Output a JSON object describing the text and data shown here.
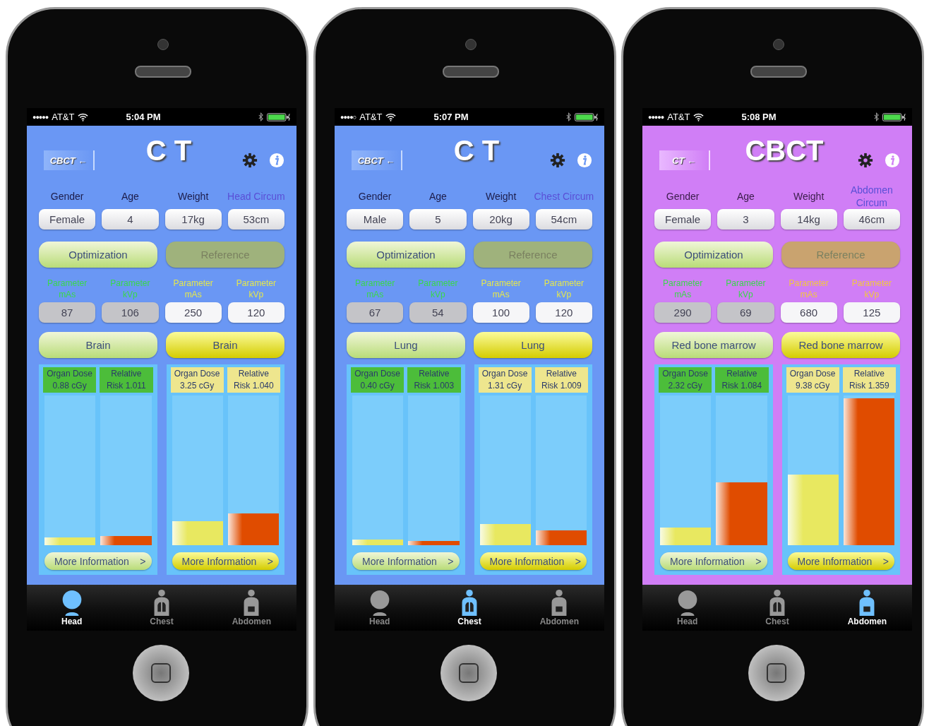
{
  "phones": [
    {
      "kind": "ct",
      "status": {
        "signal": "●●●●●",
        "carrier": "AT&T",
        "time": "5:04 PM"
      },
      "switch_button": "CBCT ←",
      "title": "C T",
      "fields": [
        {
          "label": "Gender",
          "value": "Female",
          "color": "#1c1c4a"
        },
        {
          "label": "Age",
          "value": "4",
          "color": "#1c1c4a"
        },
        {
          "label": "Weight",
          "value": "17kg",
          "color": "#1c1c4a"
        },
        {
          "label": "Head Circum",
          "value": "53cm",
          "color": "#5a4fd6"
        }
      ],
      "mode_buttons": [
        {
          "label": "Optimization",
          "disabled": false
        },
        {
          "label": "Reference",
          "disabled": true
        }
      ],
      "params": [
        {
          "label": "Parameter mAs",
          "value": "87",
          "kind": "optimization",
          "color": "#39d84a"
        },
        {
          "label": "Parameter kVp",
          "value": "106",
          "kind": "optimization",
          "color": "#39d84a"
        },
        {
          "label": "Parameter mAs",
          "value": "250",
          "kind": "reference",
          "color": "#e6e84a"
        },
        {
          "label": "Parameter kVp",
          "value": "120",
          "kind": "reference",
          "color": "#e6e84a"
        }
      ],
      "columns": [
        {
          "kind": "optimization",
          "organ": "Brain",
          "dose": "Organ Dose\n0.88 cGy",
          "risk": "Relative\nRisk 1.011",
          "dose_bar": {
            "level": 0.05
          },
          "risk_bar": {
            "level": 0.06
          },
          "more_button": "More Information",
          "more_arrow": ">"
        },
        {
          "kind": "reference",
          "organ": "Brain",
          "dose": "Organ Dose\n3.25 cGy",
          "risk": "Relative\nRisk 1.040",
          "dose_bar": {
            "level": 0.16
          },
          "risk_bar": {
            "level": 0.21
          },
          "more_button": "More Information",
          "more_arrow": ">"
        }
      ],
      "tabs": [
        {
          "label": "Head",
          "selected": true,
          "kind": "head"
        },
        {
          "label": "Chest",
          "selected": false,
          "kind": "chest"
        },
        {
          "label": "Abdomen",
          "selected": false,
          "kind": "abdomen"
        }
      ]
    },
    {
      "kind": "ct",
      "status": {
        "signal": "●●●●○",
        "carrier": "AT&T",
        "time": "5:07 PM"
      },
      "switch_button": "CBCT ←",
      "title": "C T",
      "fields": [
        {
          "label": "Gender",
          "value": "Male",
          "color": "#1c1c4a"
        },
        {
          "label": "Age",
          "value": "5",
          "color": "#1c1c4a"
        },
        {
          "label": "Weight",
          "value": "20kg",
          "color": "#1c1c4a"
        },
        {
          "label": "Chest Circum",
          "value": "54cm",
          "color": "#5a4fd6"
        }
      ],
      "mode_buttons": [
        {
          "label": "Optimization",
          "disabled": false
        },
        {
          "label": "Reference",
          "disabled": true
        }
      ],
      "params": [
        {
          "label": "Parameter mAs",
          "value": "67",
          "kind": "optimization",
          "color": "#39d84a"
        },
        {
          "label": "Parameter kVp",
          "value": "54",
          "kind": "optimization",
          "color": "#39d84a"
        },
        {
          "label": "Parameter mAs",
          "value": "100",
          "kind": "reference",
          "color": "#e6e84a"
        },
        {
          "label": "Parameter kVp",
          "value": "120",
          "kind": "reference",
          "color": "#e6e84a"
        }
      ],
      "columns": [
        {
          "kind": "optimization",
          "organ": "Lung",
          "dose": "Organ Dose\n0.40 cGy",
          "risk": "Relative\nRisk 1.003",
          "dose_bar": {
            "level": 0.04
          },
          "risk_bar": {
            "level": 0.03
          },
          "more_button": "More Information",
          "more_arrow": ">"
        },
        {
          "kind": "reference",
          "organ": "Lung",
          "dose": "Organ Dose\n1.31 cGy",
          "risk": "Relative\nRisk 1.009",
          "dose_bar": {
            "level": 0.14
          },
          "risk_bar": {
            "level": 0.1
          },
          "more_button": "More Information",
          "more_arrow": ">"
        }
      ],
      "tabs": [
        {
          "label": "Head",
          "selected": false,
          "kind": "head"
        },
        {
          "label": "Chest",
          "selected": true,
          "kind": "chest"
        },
        {
          "label": "Abdomen",
          "selected": false,
          "kind": "abdomen"
        }
      ]
    },
    {
      "kind": "cbct",
      "status": {
        "signal": "●●●●●",
        "carrier": "AT&T",
        "time": "5:08 PM"
      },
      "switch_button": "CT ←",
      "title": "CBCT",
      "fields": [
        {
          "label": "Gender",
          "value": "Female",
          "color": "#3a1c4a"
        },
        {
          "label": "Age",
          "value": "3",
          "color": "#3a1c4a"
        },
        {
          "label": "Weight",
          "value": "14kg",
          "color": "#3a1c4a"
        },
        {
          "label": "Abdomen Circum",
          "value": "46cm",
          "color": "#5a4fd6"
        }
      ],
      "mode_buttons": [
        {
          "label": "Optimization",
          "disabled": false
        },
        {
          "label": "Reference",
          "disabled": true
        }
      ],
      "params": [
        {
          "label": "Parameter mAs",
          "value": "290",
          "kind": "optimization",
          "color": "#39d84a"
        },
        {
          "label": "Parameter kVp",
          "value": "69",
          "kind": "optimization",
          "color": "#39d84a"
        },
        {
          "label": "Parameter mAs",
          "value": "680",
          "kind": "reference",
          "color": "#f2c83c"
        },
        {
          "label": "Parameter kVp",
          "value": "125",
          "kind": "reference",
          "color": "#f2c83c"
        }
      ],
      "columns": [
        {
          "kind": "optimization",
          "organ": "Red bone marrow",
          "dose": "Organ Dose\n2.32 cGy",
          "risk": "Relative\nRisk 1.084",
          "dose_bar": {
            "level": 0.12
          },
          "risk_bar": {
            "level": 0.42
          },
          "more_button": "More Information",
          "more_arrow": ">"
        },
        {
          "kind": "reference",
          "organ": "Red bone marrow",
          "dose": "Organ Dose\n9.38 cGy",
          "risk": "Relative\nRisk 1.359",
          "dose_bar": {
            "level": 0.47
          },
          "risk_bar": {
            "level": 0.98
          },
          "more_button": "More Information",
          "more_arrow": ">"
        }
      ],
      "tabs": [
        {
          "label": "Head",
          "selected": false,
          "kind": "head"
        },
        {
          "label": "Chest",
          "selected": false,
          "kind": "chest"
        },
        {
          "label": "Abdomen",
          "selected": true,
          "kind": "abdomen"
        }
      ]
    }
  ]
}
